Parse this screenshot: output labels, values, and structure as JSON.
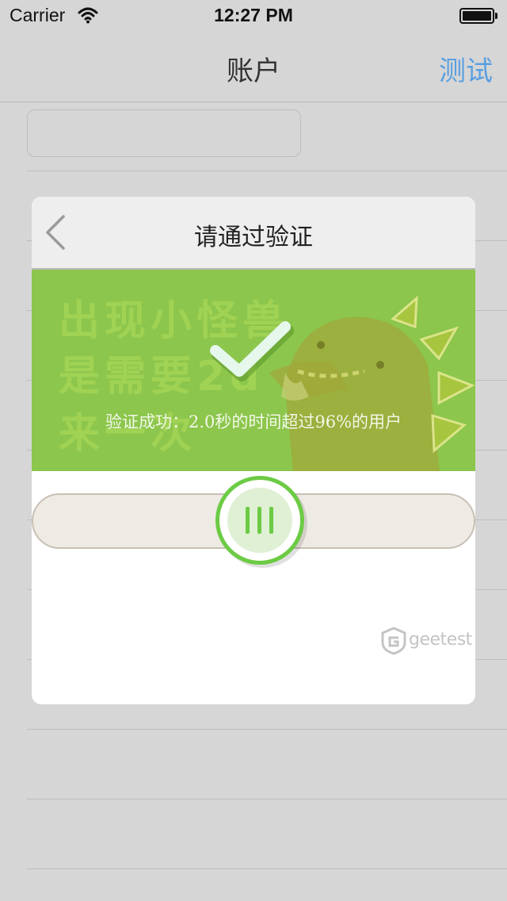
{
  "status_bar": {
    "carrier": "Carrier",
    "time": "12:27 PM",
    "wifi_icon": "wifi-icon",
    "battery_icon": "battery-icon"
  },
  "nav": {
    "title": "账户",
    "right_action": "测试",
    "accent_color": "#5a9fe0"
  },
  "dialog": {
    "title": "请通过验证",
    "back_icon": "chevron-left-icon",
    "captcha": {
      "background_text": [
        "出现小怪兽",
        "是需要2d",
        "来一次"
      ],
      "success_message": "验证成功：2.0秒的时间超过96%的用户",
      "status_icon": "checkmark-icon",
      "background_color": "#8cc64c"
    },
    "slider": {
      "handle_icon": "grip-lines-icon",
      "handle_color": "#6ccb44"
    },
    "brand": "geetest"
  }
}
